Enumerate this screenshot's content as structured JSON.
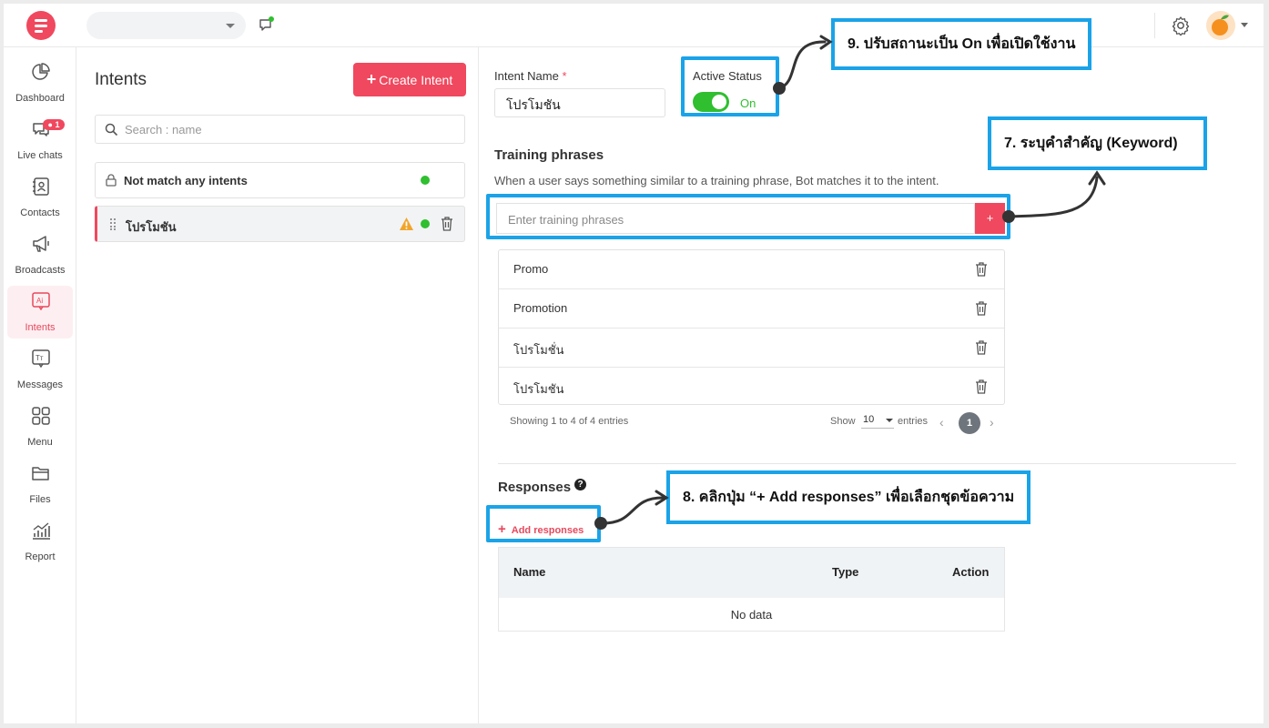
{
  "sidebar": {
    "items": [
      {
        "label": "Dashboard",
        "icon": "pie-chart-icon"
      },
      {
        "label": "Live chats",
        "icon": "chat-bubbles-icon",
        "badge": "1"
      },
      {
        "label": "Contacts",
        "icon": "contact-card-icon"
      },
      {
        "label": "Broadcasts",
        "icon": "megaphone-icon"
      },
      {
        "label": "Intents",
        "icon": "ai-icon",
        "active": true
      },
      {
        "label": "Messages",
        "icon": "text-message-icon"
      },
      {
        "label": "Menu",
        "icon": "grid-menu-icon"
      },
      {
        "label": "Files",
        "icon": "folder-icon"
      },
      {
        "label": "Report",
        "icon": "bar-report-icon"
      }
    ]
  },
  "intents": {
    "title": "Intents",
    "create_label": "Create Intent",
    "search_placeholder": "Search : name",
    "list": [
      {
        "label": "Not match any intents",
        "status": "active"
      },
      {
        "label": "โปรโมชัน",
        "status": "active",
        "warning": true,
        "selected": true
      }
    ]
  },
  "form": {
    "intent_name_label": "Intent Name",
    "required_mark": "*",
    "intent_name_value": "โปรโมชัน",
    "active_status_label": "Active Status",
    "active_status_value": "On",
    "training_title": "Training phrases",
    "training_hint": "When a user says something similar to a training phrase, Bot matches it to the intent.",
    "training_placeholder": "Enter training phrases",
    "add_phrase_label": "+",
    "phrases": [
      "Promo",
      "Promotion",
      "โปรโมชั่น",
      "โปรโมชัน"
    ],
    "showing_text": "Showing 1 to 4 of 4 entries",
    "show_label": "Show",
    "page_length": "10",
    "entries_label": "entries",
    "prev": "‹",
    "current_page": "1",
    "next": "›",
    "responses_title": "Responses",
    "help_glyph": "?",
    "add_responses_label": "Add responses",
    "table_headers": [
      "Name",
      "Type",
      "Action"
    ],
    "no_data": "No data"
  },
  "callouts": {
    "step9": "9. ปรับสถานะเป็น On เพื่อเปิดใช้งาน",
    "step7": "7. ระบุคำสำคัญ (Keyword)",
    "step8": "8. คลิกปุ่ม “+ Add responses” เพื่อเลือกชุดข้อความ"
  },
  "colors": {
    "brand": "#f0485e",
    "active_green": "#2fbf2f",
    "annotation_blue": "#1aa3e8",
    "warning": "#f0a52a"
  }
}
